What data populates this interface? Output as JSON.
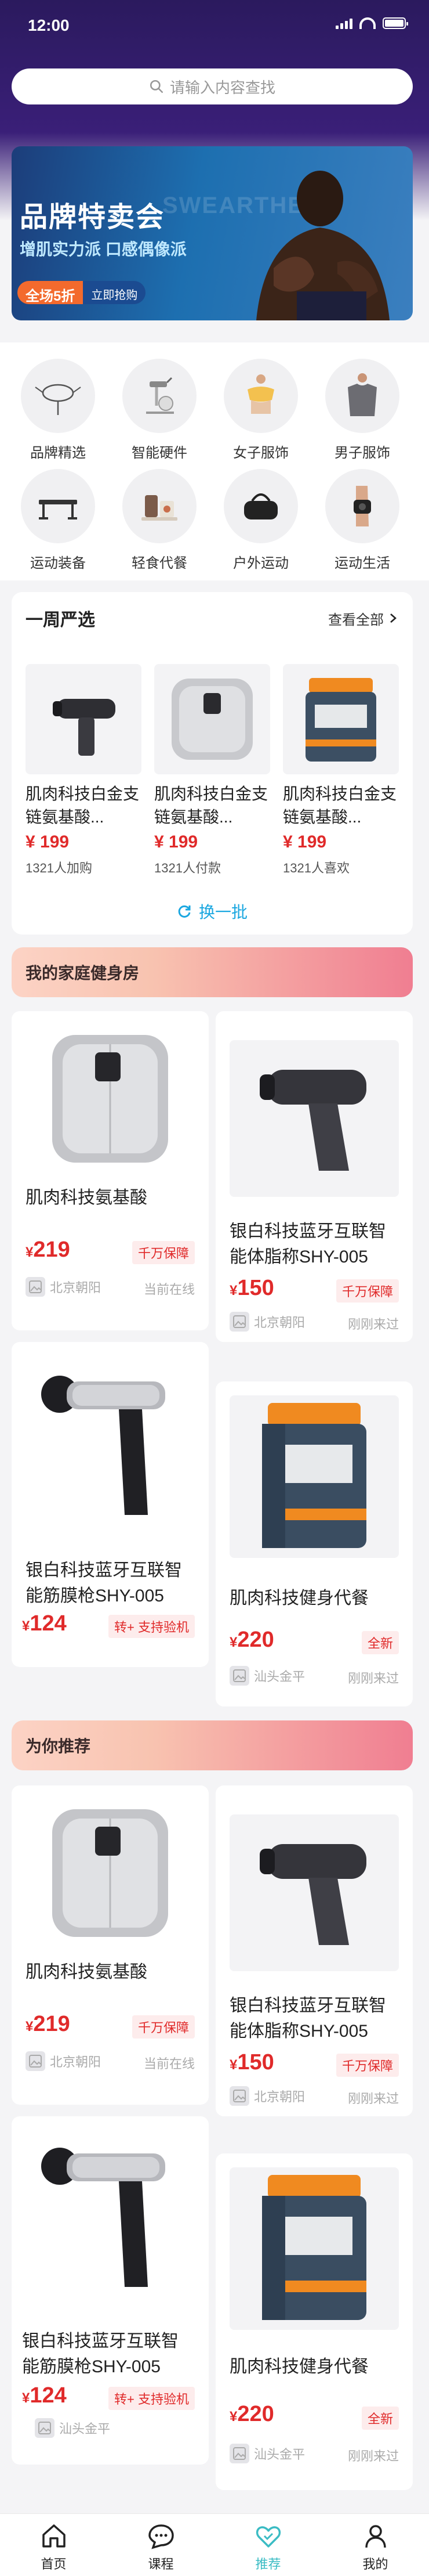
{
  "status": {
    "time": "12:00"
  },
  "search": {
    "placeholder": "请输入内容查找"
  },
  "banner": {
    "title": "品牌特卖会",
    "subtitle": "增肌实力派 口感偶像派",
    "badge": "全场5折",
    "cta": "立即抢购",
    "bg_text": "SWEARTHE"
  },
  "categories": [
    {
      "label": "品牌精选",
      "icon": "mirror-icon"
    },
    {
      "label": "智能硬件",
      "icon": "exercise-bike-icon"
    },
    {
      "label": "女子服饰",
      "icon": "sports-bra-icon"
    },
    {
      "label": "男子服饰",
      "icon": "mens-shirt-icon"
    },
    {
      "label": "运动装备",
      "icon": "bench-icon"
    },
    {
      "label": "轻食代餐",
      "icon": "meal-icon"
    },
    {
      "label": "户外运动",
      "icon": "gym-bag-icon"
    },
    {
      "label": "运动生活",
      "icon": "knee-brace-icon"
    }
  ],
  "weekly": {
    "title": "一周严选",
    "see_all": "查看全部",
    "refresh": "换一批",
    "items": [
      {
        "name": "肌肉科技白金支链氨基酸...",
        "price": "¥ 199",
        "meta": "1321人加购",
        "image": "massage-gun"
      },
      {
        "name": "肌肉科技白金支链氨基酸...",
        "price": "¥ 199",
        "meta": "1321人付款",
        "image": "massager"
      },
      {
        "name": "肌肉科技白金支链氨基酸...",
        "price": "¥ 199",
        "meta": "1321人喜欢",
        "image": "supplement-tub"
      }
    ]
  },
  "home_gym": {
    "title": "我的家庭健身房",
    "cards": [
      {
        "name": "肌肉科技氨基酸",
        "price_symbol": "¥",
        "price": "219",
        "tag": "千万保障",
        "location": "北京朝阳",
        "status": "当前在线",
        "image": "massager"
      },
      {
        "name": "银白科技蓝牙互联智能体脂称SHY-005",
        "price_symbol": "¥",
        "price": "150",
        "tag": "千万保障",
        "location": "北京朝阳",
        "status": "刚刚来过",
        "image": "massage-gun-dark"
      },
      {
        "name": "银白科技蓝牙互联智能筋膜枪SHY-005",
        "price_symbol": "¥",
        "price": "124",
        "tag": "转+ 支持验机",
        "location": "",
        "status": "",
        "image": "massage-gun"
      },
      {
        "name": "肌肉科技健身代餐",
        "price_symbol": "¥",
        "price": "220",
        "tag": "全新",
        "location": "汕头金平",
        "status": "刚刚来过",
        "image": "supplement-tub"
      }
    ]
  },
  "recommend": {
    "title": "为你推荐",
    "cards": [
      {
        "name": "肌肉科技氨基酸",
        "price_symbol": "¥",
        "price": "219",
        "tag": "千万保障",
        "location": "北京朝阳",
        "status": "当前在线",
        "image": "massager"
      },
      {
        "name": "银白科技蓝牙互联智能体脂称SHY-005",
        "price_symbol": "¥",
        "price": "150",
        "tag": "千万保障",
        "location": "北京朝阳",
        "status": "刚刚来过",
        "image": "massage-gun-dark"
      },
      {
        "name": "银白科技蓝牙互联智能筋膜枪SHY-005",
        "price_symbol": "¥",
        "price": "124",
        "tag": "转+ 支持验机",
        "location": "汕头金平",
        "status": "",
        "image": "massage-gun"
      },
      {
        "name": "肌肉科技健身代餐",
        "price_symbol": "¥",
        "price": "220",
        "tag": "全新",
        "location": "汕头金平",
        "status": "刚刚来过",
        "image": "supplement-tub"
      }
    ]
  },
  "tabbar": [
    {
      "label": "首页",
      "icon": "home-icon",
      "active": false
    },
    {
      "label": "课程",
      "icon": "chat-icon",
      "active": false
    },
    {
      "label": "推荐",
      "icon": "heart-icon",
      "active": true
    },
    {
      "label": "我的",
      "icon": "user-icon",
      "active": false
    }
  ],
  "colors": {
    "primary_purple": "#3a1f78",
    "price_red": "#e02a2a",
    "accent_cyan": "#3bbcc4",
    "refresh_blue": "#1aa7e0"
  }
}
